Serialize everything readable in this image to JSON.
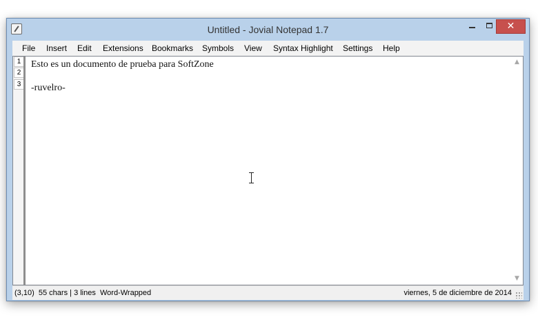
{
  "window": {
    "title": "Untitled - Jovial Notepad 1.7",
    "close_symbol": "✕"
  },
  "menu": [
    "File",
    "Insert",
    "Edit",
    "Extensions",
    "Bookmarks",
    "Symbols",
    "View",
    "Syntax Highlight",
    "Settings",
    "Help"
  ],
  "editor": {
    "line_numbers": [
      "1",
      "2",
      "3"
    ],
    "lines": [
      "Esto es un documento de prueba para SoftZone",
      "",
      "-ruvelro-"
    ]
  },
  "status": {
    "position": "(3,10)",
    "chars": "55 chars",
    "lines": "3 lines",
    "wrap": "Word-Wrapped",
    "date": "viernes, 5 de diciembre de 2014"
  },
  "colors": {
    "close_button": "#c7504d",
    "titlebar": "#b9d1ea"
  },
  "icons": [
    "notepad-app-icon",
    "minimize-icon",
    "maximize-icon",
    "close-icon",
    "scroll-up-icon",
    "scroll-down-icon",
    "text-cursor-icon",
    "resize-grip-icon"
  ]
}
